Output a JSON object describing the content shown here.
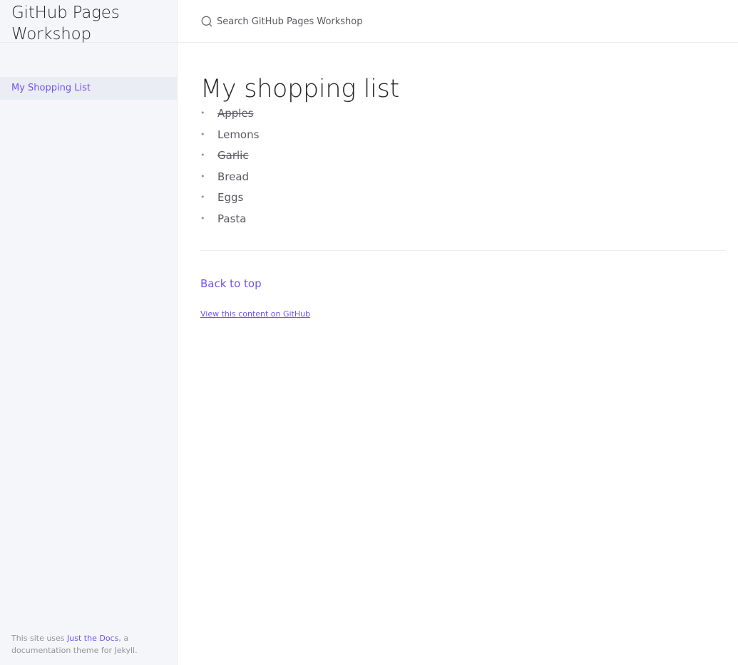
{
  "site": {
    "title_line1": "GitHub Pages",
    "title_line2": "Workshop"
  },
  "sidebar": {
    "items": [
      {
        "label": "My Shopping List"
      }
    ]
  },
  "footer": {
    "prefix": "This site uses ",
    "link_text": "Just the Docs",
    "suffix": ", a documentation theme for Jekyll."
  },
  "search": {
    "placeholder": "Search GitHub Pages Workshop",
    "icon": "search-icon"
  },
  "page": {
    "title": "My shopping list",
    "items": [
      {
        "label": "Apples",
        "done": true
      },
      {
        "label": "Lemons",
        "done": false
      },
      {
        "label": "Garlic",
        "done": true
      },
      {
        "label": "Bread",
        "done": false
      },
      {
        "label": "Eggs",
        "done": false
      },
      {
        "label": "Pasta",
        "done": false
      }
    ],
    "back_to_top": "Back to top",
    "edit_link": "View this content on GitHub"
  },
  "colors": {
    "accent": "#7253ed",
    "sidebar_bg": "#f5f6fa",
    "nav_active_bg": "#ebedf5",
    "text": "#5c5962",
    "heading": "#27262b"
  }
}
